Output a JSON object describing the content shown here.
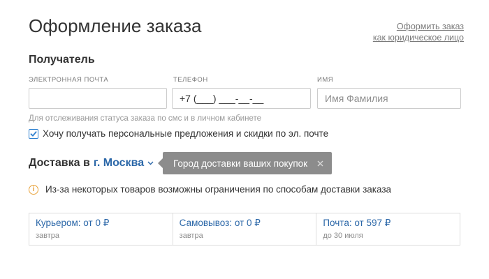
{
  "header": {
    "title": "Оформление заказа",
    "legal_link_line1": "Оформить заказ",
    "legal_link_line2": "как юридическое лицо"
  },
  "recipient": {
    "section_title": "Получатель",
    "email": {
      "label": "ЭЛЕКТРОННАЯ ПОЧТА",
      "value": "",
      "placeholder": ""
    },
    "phone": {
      "label": "ТЕЛЕФОН",
      "value": "+7 (___) ___-__-__",
      "placeholder": ""
    },
    "name": {
      "label": "ИМЯ",
      "value": "",
      "placeholder": "Имя Фамилия"
    },
    "helper_text": "Для отслеживания статуса заказа по смс и в личном кабинете",
    "consent": {
      "label": "Хочу получать персональные предложения и скидки по эл. почте",
      "checked": true
    }
  },
  "delivery": {
    "title_prefix": "Доставка в",
    "city": "г. Москва",
    "city_icon": "chevron-down-icon",
    "tooltip": {
      "text": "Город доставки ваших покупок",
      "close_icon": "close-icon"
    },
    "notice": {
      "icon": "info-icon",
      "icon_glyph": "i",
      "text": "Из-за некоторых товаров возможны ограничения по способам доставки заказа"
    },
    "options": [
      {
        "title": "Курьером: от 0 ₽",
        "subtitle": "завтра"
      },
      {
        "title": "Самовывоз: от 0 ₽",
        "subtitle": "завтра"
      },
      {
        "title": "Почта: от 597 ₽",
        "subtitle": "до 30 июля"
      }
    ]
  },
  "colors": {
    "link_blue": "#2b67a8",
    "checkbox_blue": "#2b7fd0",
    "warning_orange": "#e8a23a",
    "tooltip_gray": "#8c8c8c",
    "text_dark": "#333333",
    "text_muted": "#9a9a9a"
  }
}
